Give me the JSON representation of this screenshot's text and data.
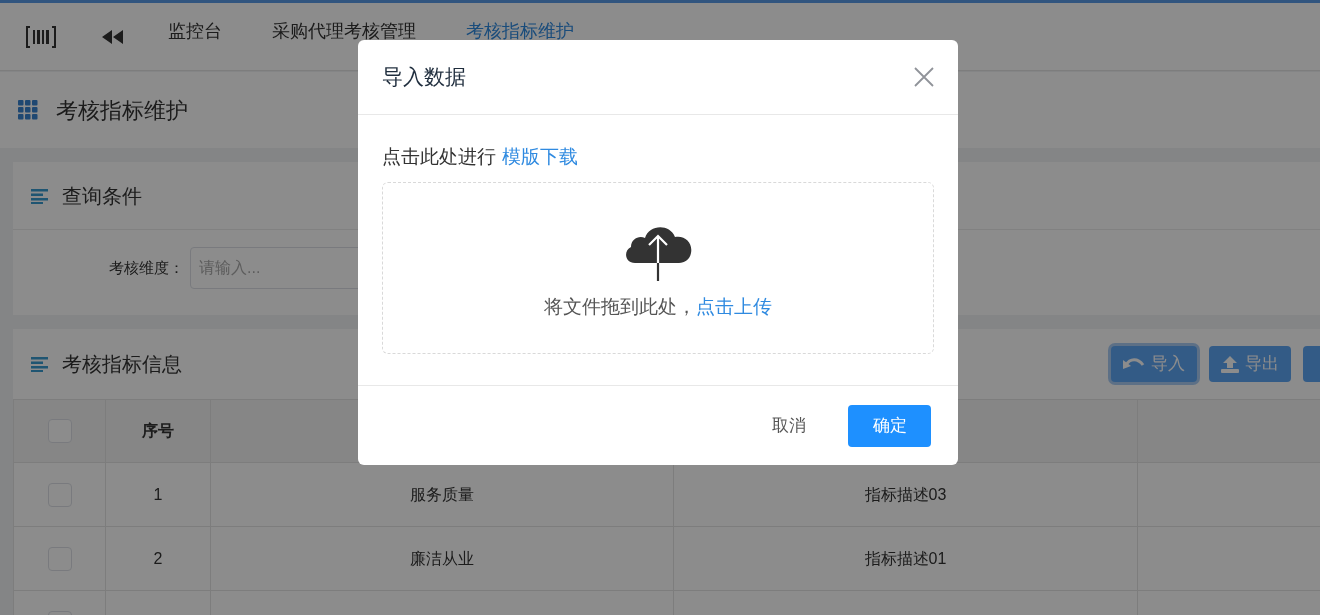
{
  "nav": {
    "tabs": [
      {
        "label": "监控台",
        "selected": false
      },
      {
        "label": "采购代理考核管理",
        "selected": false
      },
      {
        "label": "考核指标维护",
        "selected": true
      }
    ]
  },
  "page_title": "考核指标维护",
  "query_panel": {
    "title": "查询条件",
    "fields": [
      {
        "label": "考核维度：",
        "placeholder": "请输入..."
      }
    ]
  },
  "info_panel": {
    "title": "考核指标信息",
    "buttons": [
      {
        "label": "导入",
        "kind": "import",
        "focused": true
      },
      {
        "label": "导出",
        "kind": "export",
        "focused": false
      }
    ]
  },
  "table": {
    "header": {
      "checked": false,
      "columns": [
        "序号"
      ]
    },
    "rows": [
      {
        "checked": false,
        "cells": [
          "1",
          "服务质量",
          "指标描述03"
        ]
      },
      {
        "checked": false,
        "cells": [
          "2",
          "廉洁从业",
          "指标描述01"
        ]
      },
      {
        "checked": false
      }
    ]
  },
  "dialog": {
    "title": "导入数据",
    "template_prompt": "点击此处进行",
    "template_link": "模版下载",
    "drop_text": "将文件拖到此处，",
    "upload_link": "点击上传",
    "buttons": [
      {
        "label": "取消",
        "kind": "text"
      },
      {
        "label": "确定",
        "kind": "primary"
      }
    ]
  }
}
